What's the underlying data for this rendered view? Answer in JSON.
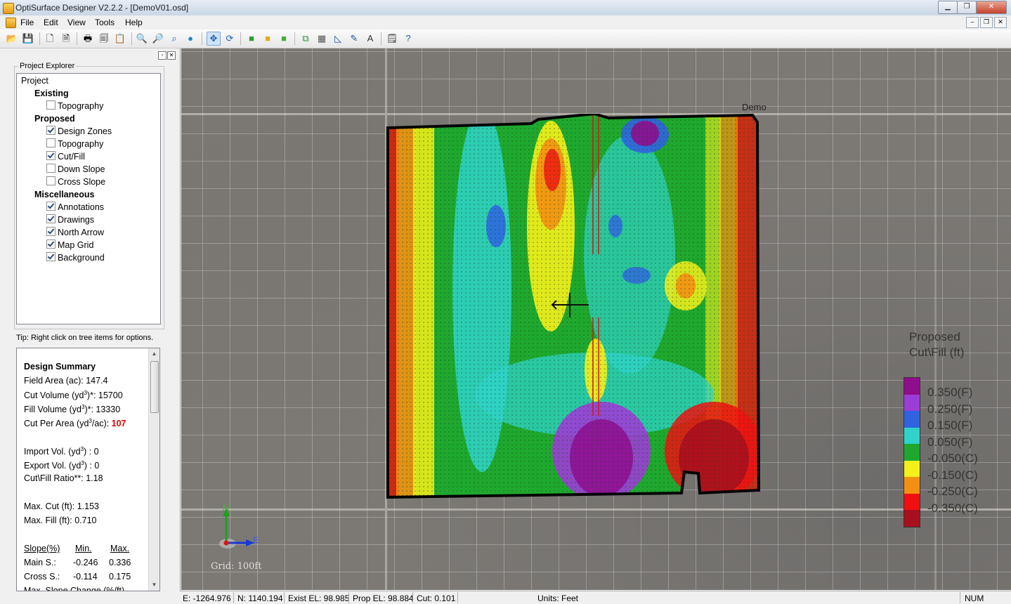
{
  "window": {
    "title": "OptiSurface Designer V2.2.2 - [DemoV01.osd]",
    "min": "▁",
    "max": "❐",
    "close": "✕"
  },
  "menu": {
    "file": "File",
    "edit": "Edit",
    "view": "View",
    "tools": "Tools",
    "help": "Help"
  },
  "mdi": {
    "min": "–",
    "restore": "❐",
    "close": "✕"
  },
  "panel": {
    "group_title": "Project Explorer",
    "tree": {
      "project": "Project",
      "existing": "Existing",
      "existing_topography": "Topography",
      "proposed": "Proposed",
      "design_zones": "Design Zones",
      "proposed_topography": "Topography",
      "cut_fill": "Cut/Fill",
      "down_slope": "Down Slope",
      "cross_slope": "Cross Slope",
      "misc": "Miscellaneous",
      "annotations": "Annotations",
      "drawings": "Drawings",
      "north_arrow": "North Arrow",
      "map_grid": "Map Grid",
      "background": "Background"
    },
    "tip": "Tip: Right click on tree items for options."
  },
  "summary": {
    "title": "Design Summary",
    "field_area": "Field Area (ac): 147.4",
    "cut_volume_label": "Cut Volume (yd",
    "cut_volume_value": ")*: 15700",
    "fill_volume_label": "Fill Volume (yd",
    "fill_volume_value": ")*: 13330",
    "cut_per_area_label": "Cut Per Area (yd",
    "cut_per_area_unit": "/ac): ",
    "cut_per_area_value": "107",
    "import_label": "Import Vol. (yd",
    "import_value": ") : 0",
    "export_label": "Export Vol. (yd",
    "export_value": ") : 0",
    "ratio": "Cut\\Fill Ratio**: 1.18",
    "max_cut": "Max. Cut (ft): 1.153",
    "max_fill": "Max. Fill (ft): 0.710",
    "slope_header": "Slope(%)",
    "slope_min": "Min.",
    "slope_max": "Max.",
    "main_label": "Main S.:",
    "main_min": "-0.246",
    "main_max": "0.336",
    "cross_label": "Cross S.:",
    "cross_min": "-0.114",
    "cross_max": "0.175",
    "cut_row": "Max. Slope Change (%/ft)"
  },
  "map": {
    "field_name": "Demo",
    "grid_label": "Grid: 100ft",
    "north": "N",
    "east": "E",
    "legend_title_1": "Proposed",
    "legend_title_2": "Cut\\Fill (ft)",
    "legend": [
      {
        "label": "0.350(F)",
        "color": "#8e0e8e"
      },
      {
        "label": "0.250(F)",
        "color": "#9b3dd6"
      },
      {
        "label": "0.150(F)",
        "color": "#2f63e0"
      },
      {
        "label": "0.050(F)",
        "color": "#2fd3c9"
      },
      {
        "label": "-0.050(C)",
        "color": "#1fa82e"
      },
      {
        "label": "-0.150(C)",
        "color": "#f4f01a"
      },
      {
        "label": "-0.250(C)",
        "color": "#f39012"
      },
      {
        "label": "-0.350(C)",
        "color": "#f01010"
      },
      {
        "label": "",
        "color": "#a8101e"
      }
    ]
  },
  "status": {
    "easting": "E: -1264.976",
    "northing": "N: 1140.194",
    "exist_el": "Exist EL: 98.985",
    "prop_el": "Prop EL: 98.884",
    "cut": "Cut: 0.101",
    "units": "Units: Feet",
    "num": "NUM"
  }
}
